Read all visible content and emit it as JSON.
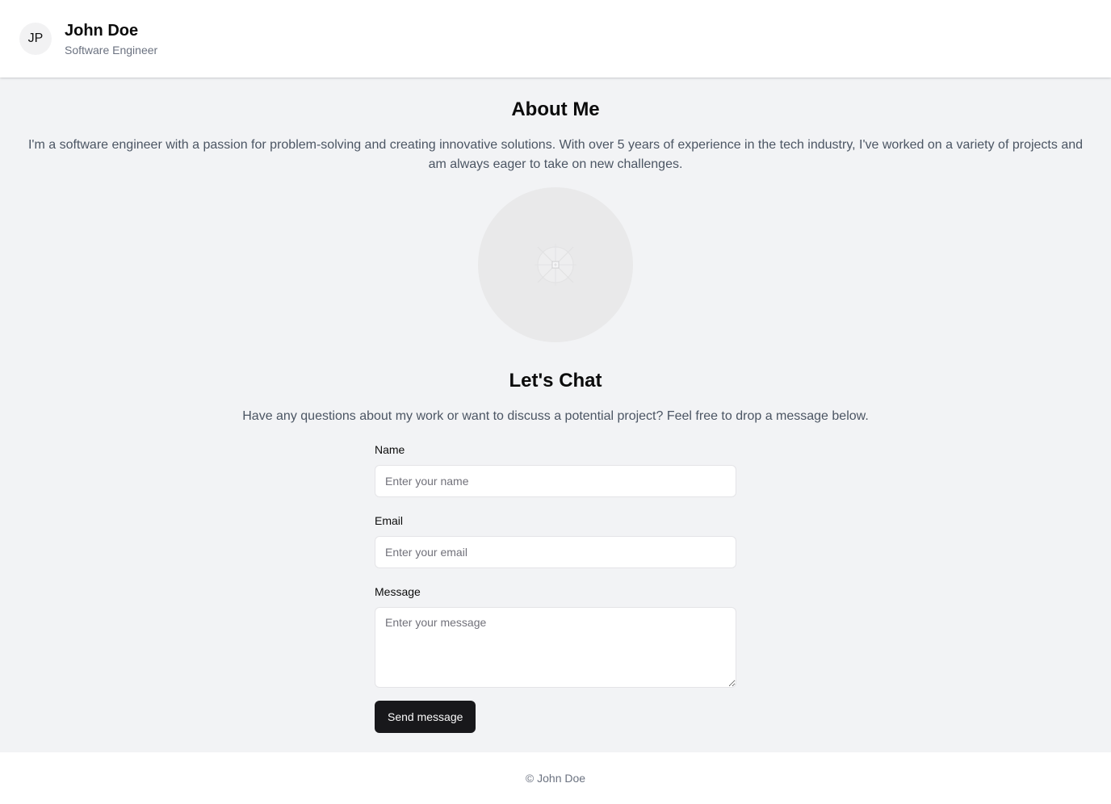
{
  "header": {
    "avatar_initials": "JP",
    "name": "John Doe",
    "role": "Software Engineer"
  },
  "about": {
    "title": "About Me",
    "text": "I'm a software engineer with a passion for problem-solving and creating innovative solutions. With over 5 years of experience in the tech industry, I've worked on a variety of projects and am always eager to take on new challenges.",
    "photo_icon": "image-placeholder-icon"
  },
  "chat": {
    "title": "Let's Chat",
    "text": "Have any questions about my work or want to discuss a potential project? Feel free to drop a message below."
  },
  "form": {
    "name_label": "Name",
    "name_placeholder": "Enter your name",
    "email_label": "Email",
    "email_placeholder": "Enter your email",
    "message_label": "Message",
    "message_placeholder": "Enter your message",
    "submit_label": "Send message"
  },
  "footer": {
    "text": "© John Doe"
  },
  "colors": {
    "page_background": "#f2f3f5",
    "surface": "#ffffff",
    "button_background": "#18181b",
    "muted_text": "#6b7280"
  }
}
